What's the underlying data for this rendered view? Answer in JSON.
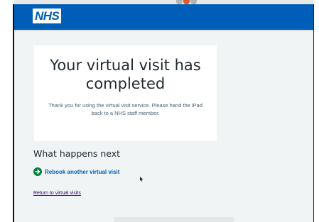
{
  "header": {
    "logo_text": "NHS"
  },
  "panel": {
    "title": "Your virtual visit has completed",
    "message": "Thank you for using the virtual visit service. Please hand the iPad back to a NHS staff member."
  },
  "next": {
    "heading": "What happens next",
    "rebook_label": "Rebook another virtual visit",
    "return_label": "Return to virtual visits"
  },
  "icons": {
    "rebook": "arrow-right-circle-icon",
    "cursor": "mouse-pointer-icon"
  },
  "colors": {
    "header": "#005eb8",
    "page_background": "#f0f4f5",
    "link": "#005eb8",
    "visited_link": "#330072",
    "arrow_circle": "#007f3b"
  }
}
